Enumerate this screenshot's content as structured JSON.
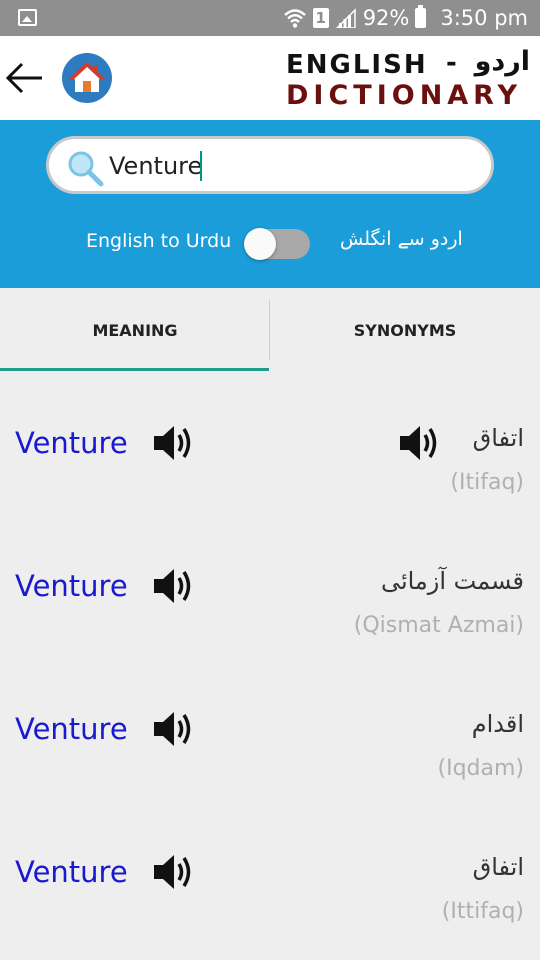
{
  "status_bar": {
    "battery": "92%",
    "time": "3:50 pm",
    "sim": "1"
  },
  "app_bar": {
    "brand_english": "ENGLISH",
    "brand_dash": "-",
    "brand_urdu": "اردو",
    "brand_dictionary": "DICTIONARY"
  },
  "search": {
    "value": "Venture"
  },
  "toggle": {
    "left_label": "English to Urdu",
    "right_label": "اردو سے انگلش",
    "state": "off"
  },
  "tabs": [
    {
      "label": "MEANING",
      "selected": true
    },
    {
      "label": "SYNONYMS",
      "selected": false
    }
  ],
  "results": [
    {
      "word": "Venture",
      "urdu": "اتفاق",
      "roman": "(Itifaq)",
      "has_urdu_speaker": true
    },
    {
      "word": "Venture",
      "urdu": "قسمت آزمائی",
      "roman": "(Qismat Azmai)",
      "has_urdu_speaker": false
    },
    {
      "word": "Venture",
      "urdu": "اقدام",
      "roman": "(Iqdam)",
      "has_urdu_speaker": false
    },
    {
      "word": "Venture",
      "urdu": "اتفاق",
      "roman": "(Ittifaq)",
      "has_urdu_speaker": false
    }
  ],
  "colors": {
    "accent_blue": "#1a9dd8",
    "word_blue": "#1919cf",
    "tab_indicator": "#1e9c8c",
    "brand_dark_red": "#6b0f0f"
  }
}
